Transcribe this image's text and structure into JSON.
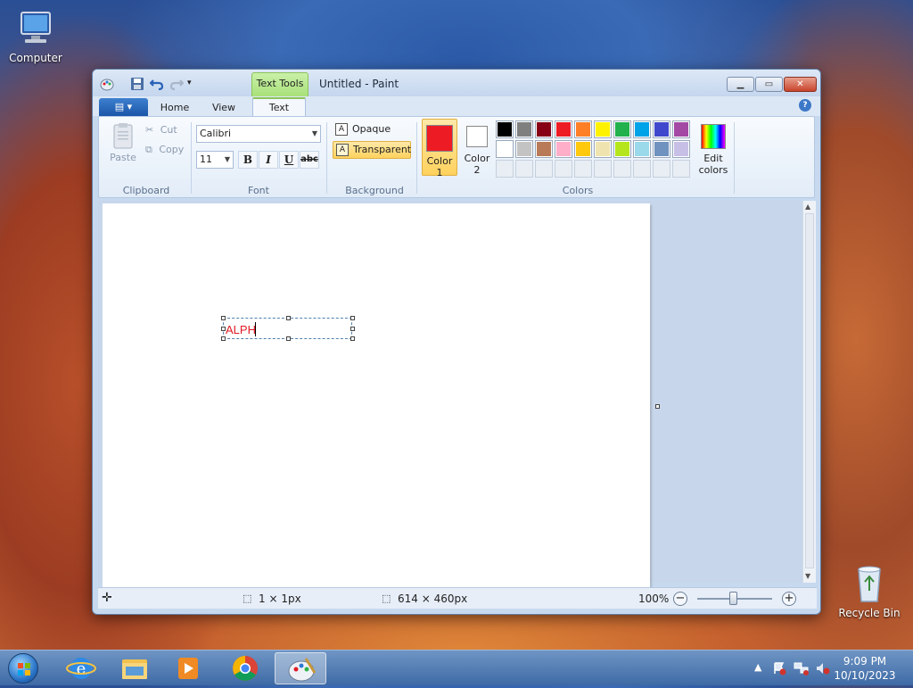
{
  "desktop": {
    "icons": [
      {
        "label": "Computer"
      },
      {
        "label": "Recycle Bin"
      }
    ]
  },
  "window": {
    "title": "Untitled - Paint",
    "context_tab": "Text Tools",
    "tabs": [
      "Home",
      "View",
      "Text"
    ],
    "active_tab": "Text"
  },
  "ribbon": {
    "clipboard": {
      "label": "Clipboard",
      "paste": "Paste",
      "cut": "Cut",
      "copy": "Copy"
    },
    "font": {
      "label": "Font",
      "family": "Calibri",
      "size": "11",
      "bold": "B",
      "italic": "I",
      "underline": "U",
      "strike": "abc"
    },
    "background": {
      "label": "Background",
      "opaque": "Opaque",
      "transparent": "Transparent",
      "selected": "Transparent"
    },
    "colors": {
      "label": "Colors",
      "color1_label": "Color\n1",
      "color1_a": "Color",
      "color1_b": "1",
      "color2_a": "Color",
      "color2_b": "2",
      "color1": "#ed1c24",
      "color2": "#ffffff",
      "edit_a": "Edit",
      "edit_b": "colors",
      "palette_row1": [
        "#000000",
        "#7f7f7f",
        "#880015",
        "#ed1c24",
        "#ff7f27",
        "#fff200",
        "#22b14c",
        "#00a2e8",
        "#3f48cc",
        "#a349a4"
      ],
      "palette_row2": [
        "#ffffff",
        "#c3c3c3",
        "#b97a57",
        "#ffaec9",
        "#ffc90e",
        "#efe4b0",
        "#b5e61d",
        "#99d9ea",
        "#7092be",
        "#c8bfe7"
      ]
    }
  },
  "canvas": {
    "text": "ALPH"
  },
  "statusbar": {
    "selection_size": "1 × 1px",
    "canvas_size": "614 × 460px",
    "zoom": "100%"
  },
  "taskbar": {
    "time": "9:09 PM",
    "date": "10/10/2023"
  }
}
